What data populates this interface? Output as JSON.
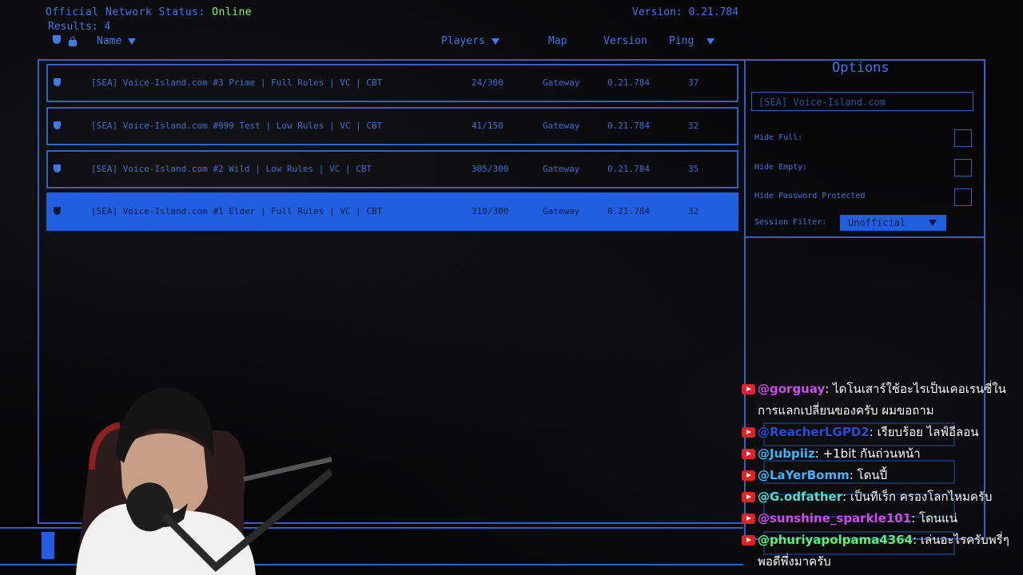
{
  "status": {
    "label": "Official Network Status:",
    "value": "Online"
  },
  "results": "Results: 4",
  "version": "Version: 0.21.784",
  "headers": {
    "name": "Name",
    "players": "Players",
    "map": "Map",
    "version": "Version",
    "ping": "Ping"
  },
  "servers": [
    {
      "name": "[SEA] Voice-Island.com #3 Prime | Full Rules | VC | CBT",
      "players": "24/300",
      "map": "Gateway",
      "version": "0.21.784",
      "ping": "37"
    },
    {
      "name": "[SEA] Voice-Island.com #999 Test | Low Rules | VC | CBT",
      "players": "41/150",
      "map": "Gateway",
      "version": "0.21.784",
      "ping": "32"
    },
    {
      "name": "[SEA] Voice-Island.com #2 Wild | Low Rules | VC | CBT",
      "players": "305/300",
      "map": "Gateway",
      "version": "0.21.784",
      "ping": "35"
    },
    {
      "name": "[SEA] Voice-Island.com #1 Elder | Full Rules | VC | CBT",
      "players": "310/300",
      "map": "Gateway",
      "version": "0.21.784",
      "ping": "32"
    }
  ],
  "options": {
    "title": "Options",
    "search_value": "[SEA] Voice-Island.com",
    "hide_full": "Hide Full:",
    "hide_empty": "Hide Empty:",
    "hide_password": "Hide Password Protected",
    "session_filter": "Session Filter:",
    "session_value": "Unofficial"
  },
  "chat": [
    {
      "user": "@gorguay",
      "color": "#d24cf0",
      "text": ": ไดโนเสาร์ใช้อะไรเป็นเคอเรนซี่ในการแลกเปลี่ยนของครับ ผมขอถาม"
    },
    {
      "user": "@ReacherLGPD2",
      "color": "#2a4fd6",
      "text": ": เรียบร้อย ไลฟ์อีลอน"
    },
    {
      "user": "@Jubpiiz",
      "color": "#3bb6ff",
      "text": ": +1bit กันถ่วนหน้า"
    },
    {
      "user": "@LaYerBomm",
      "color": "#3bb6ff",
      "text": ": โดนปี้"
    },
    {
      "user": "@G.odfather",
      "color": "#4ce0d6",
      "text": ": เป็นทีเร็ก ครองโลกไหมครับ"
    },
    {
      "user": "@sunshine_sparkle101",
      "color": "#d24cf0",
      "text": ": โดนแน่"
    },
    {
      "user": "@phuriyapolpama4364",
      "color": "#5cf07a",
      "text": ": เล่นอะไรครับพรี่ๆ พอดีพึ่งมาครับ"
    }
  ]
}
